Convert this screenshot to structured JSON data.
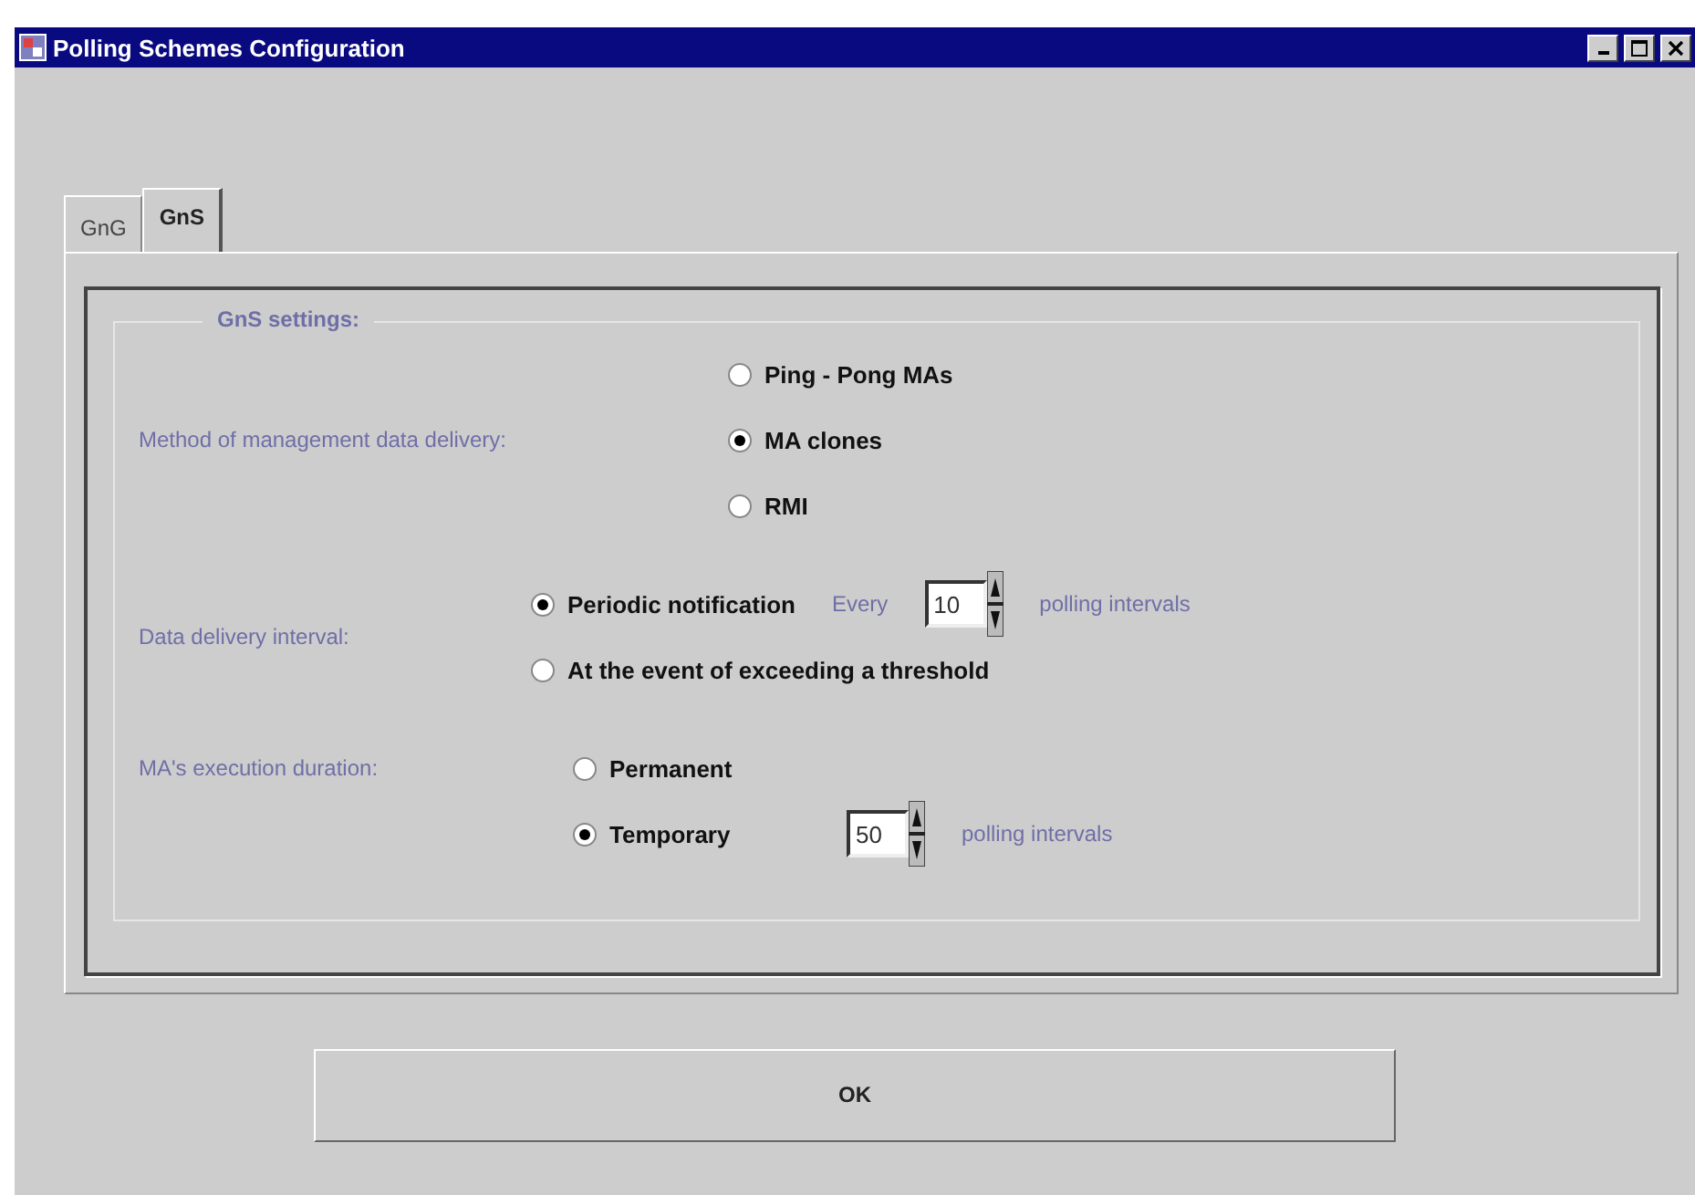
{
  "window": {
    "title": "Polling Schemes Configuration"
  },
  "tabs": [
    {
      "label": "GnG",
      "selected": false
    },
    {
      "label": "GnS",
      "selected": true
    }
  ],
  "group": {
    "title": "GnS settings:"
  },
  "sections": [
    {
      "label": "Method of management data delivery:",
      "options": [
        {
          "label": "Ping - Pong MAs",
          "selected": false
        },
        {
          "label": "MA clones",
          "selected": true
        },
        {
          "label": "RMI",
          "selected": false
        }
      ]
    },
    {
      "label": "Data delivery interval:",
      "options": [
        {
          "label": "Periodic notification",
          "selected": true,
          "prefix": "Every",
          "spinner": "10",
          "suffix": "polling intervals"
        },
        {
          "label": "At the event of exceeding a threshold",
          "selected": false
        }
      ]
    },
    {
      "label": "MA's execution duration:",
      "options": [
        {
          "label": "Permanent",
          "selected": false
        },
        {
          "label": "Temporary",
          "selected": true,
          "spinner": "50",
          "suffix": "polling intervals"
        }
      ]
    }
  ],
  "buttons": [
    "OK"
  ]
}
